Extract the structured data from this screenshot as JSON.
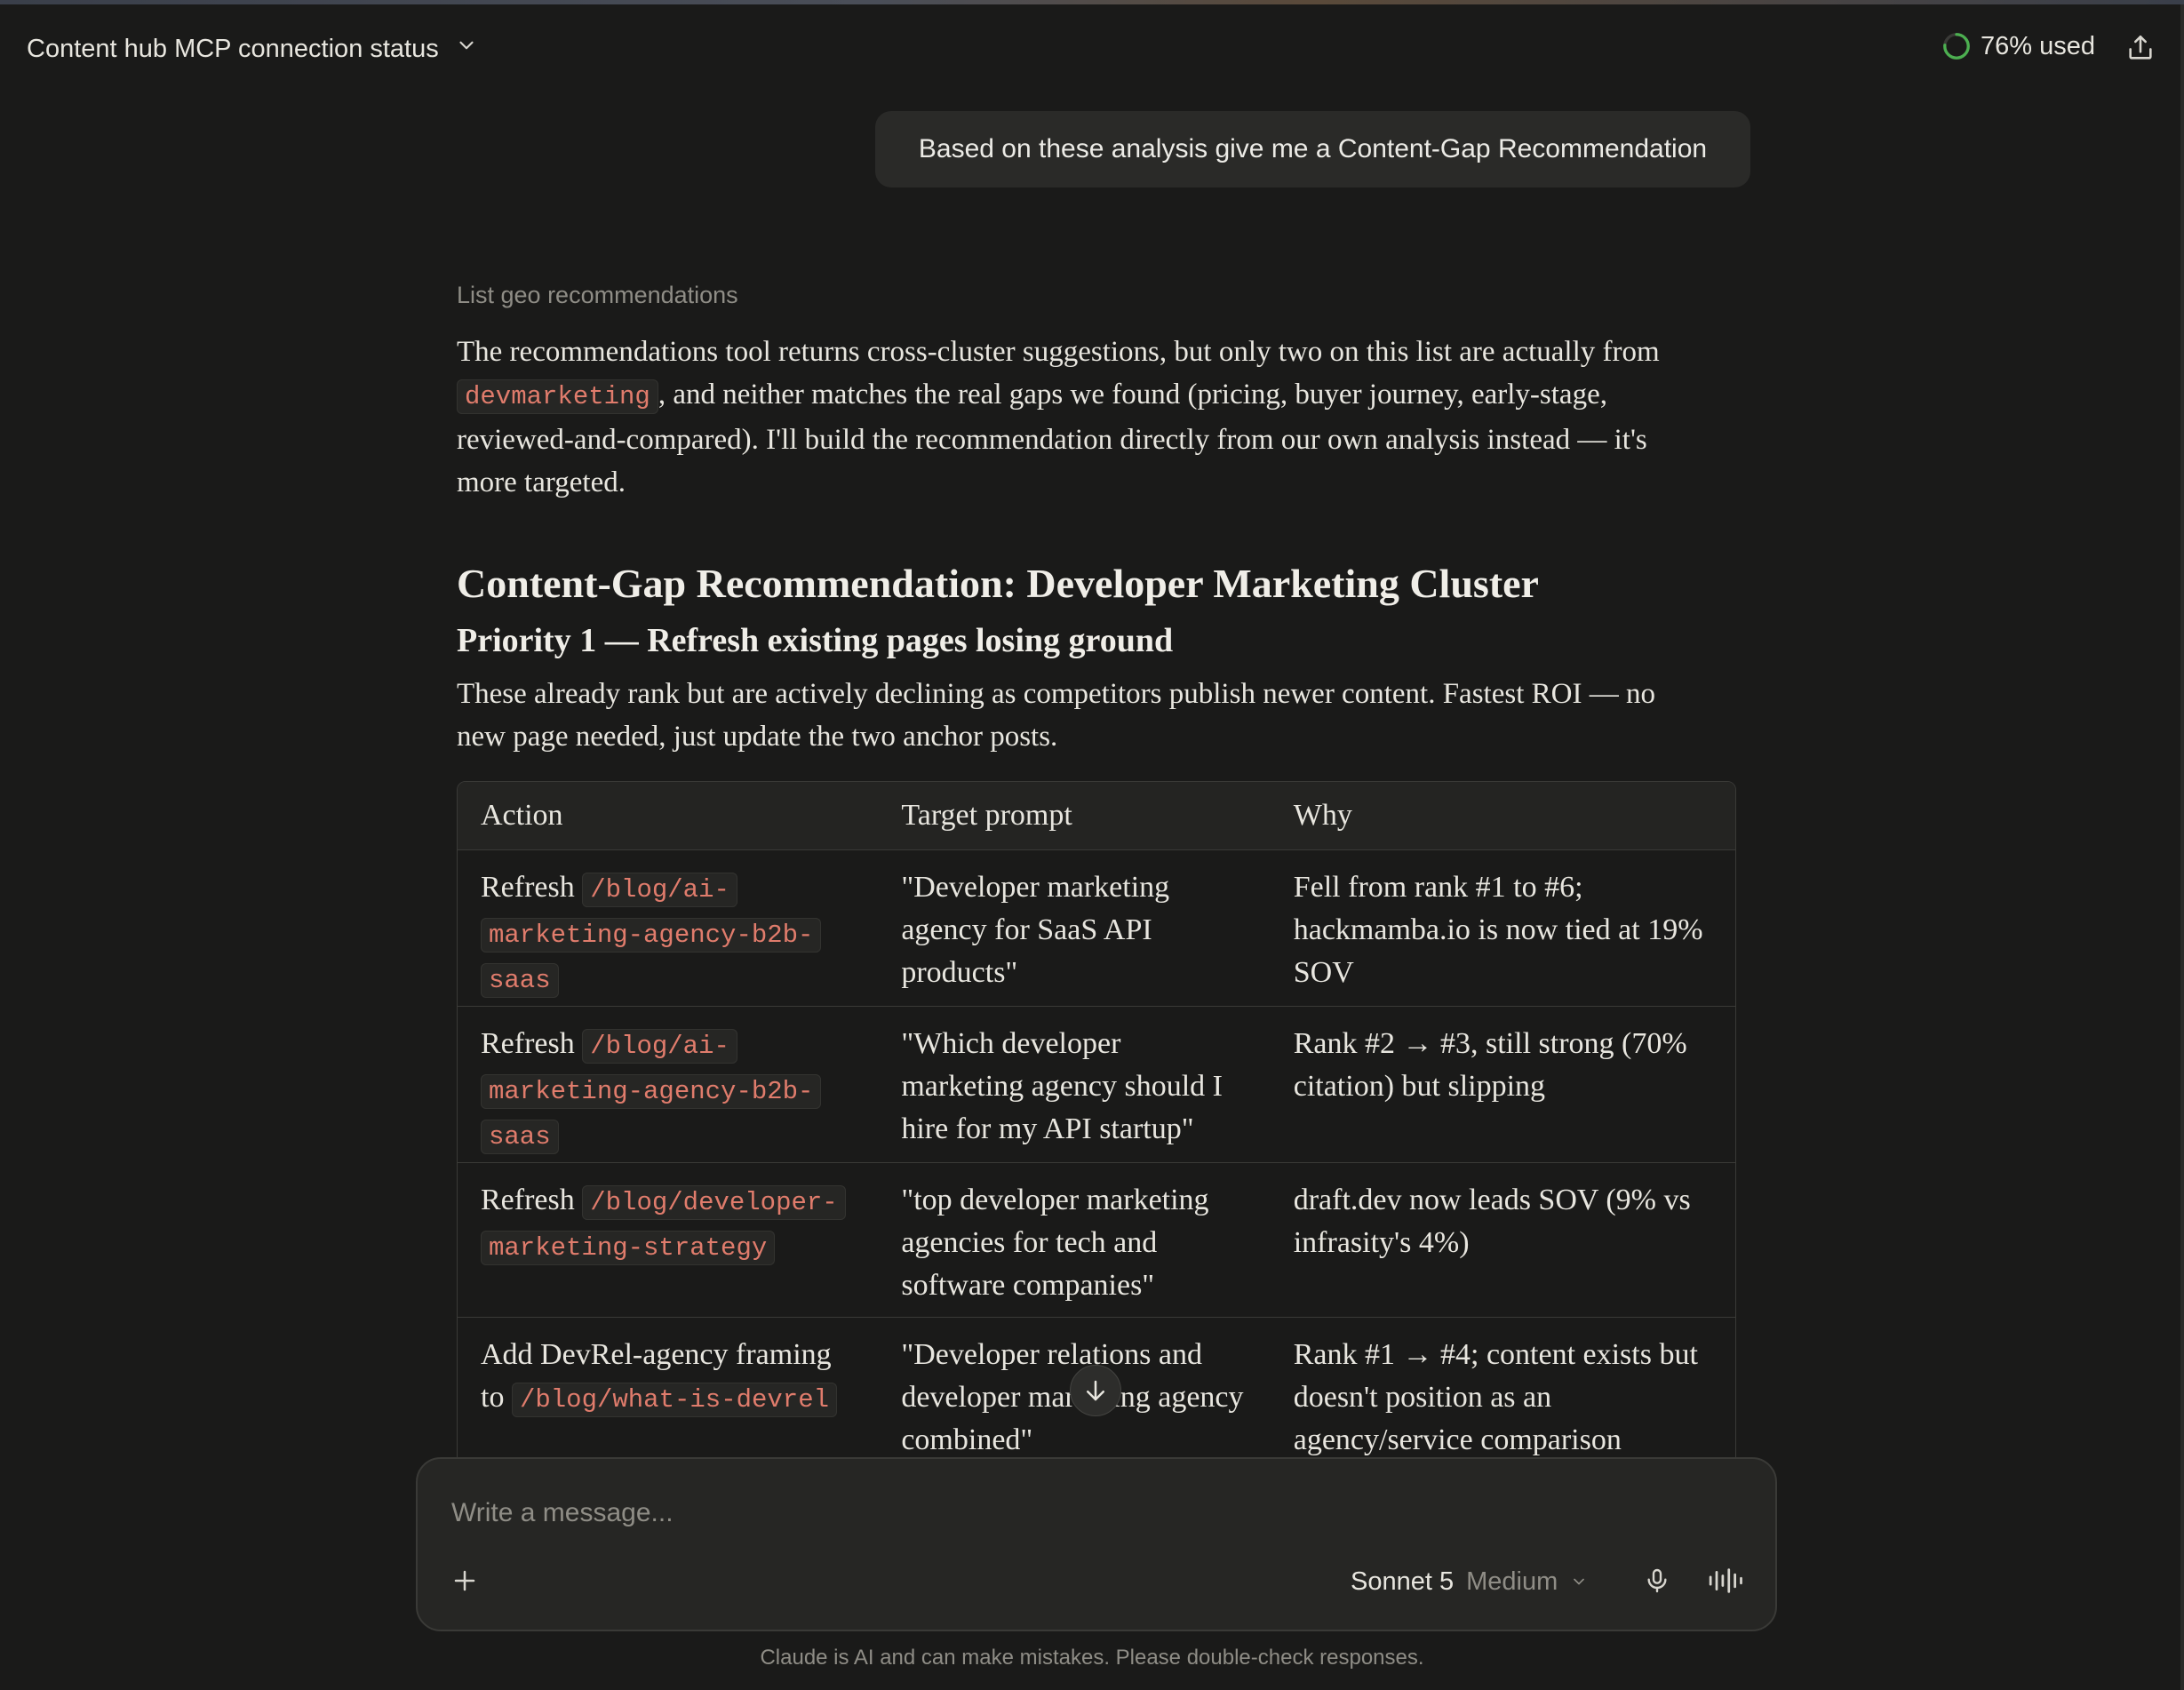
{
  "header": {
    "title": "Content hub MCP connection status",
    "usage_label": "76% used",
    "usage_fraction": 0.76,
    "usage_color": "#4caf50"
  },
  "user_message": "Based on these analysis give me a Content-Gap Recommendation",
  "assistant": {
    "tool_label": "List geo recommendations",
    "intro_part1": "The recommendations tool returns cross-cluster suggestions, but only two on this list are actually from ",
    "intro_code": "devmarketing",
    "intro_part2": ", and neither matches the real gaps we found (pricing, buyer journey, early-stage, reviewed-and-compared). I'll build the recommendation directly from our own analysis instead — it's more targeted.",
    "heading": "Content-Gap Recommendation: Developer Marketing Cluster",
    "subheading": "Priority 1 — Refresh existing pages losing ground",
    "subtext": "These already rank but are actively declining as competitors publish newer content. Fastest ROI — no new page needed, just update the two anchor posts.",
    "table": {
      "headers": [
        "Action",
        "Target prompt",
        "Why"
      ],
      "rows": [
        {
          "action_prefix": "Refresh ",
          "action_code": "/blog/ai-marketing-agency-b2b-saas",
          "action_code_lines": [
            "/blog/ai-",
            "marketing-agency-b2b-",
            "saas"
          ],
          "prompt": "\"Developer marketing agency for SaaS API products\"",
          "why": "Fell from rank #1 to #6; hackmamba.io is now tied at 19% SOV"
        },
        {
          "action_prefix": "Refresh ",
          "action_code": "/blog/ai-marketing-agency-b2b-saas",
          "action_code_lines": [
            "/blog/ai-",
            "marketing-agency-b2b-",
            "saas"
          ],
          "prompt": "\"Which developer marketing agency should I hire for my API startup\"",
          "why": "Rank #2 → #3, still strong (70% citation) but slipping"
        },
        {
          "action_prefix": "Refresh ",
          "action_code": "/blog/developer-marketing-strategy",
          "action_code_lines": [
            "/blog/developer-",
            "marketing-strategy"
          ],
          "prompt": "\"top developer marketing agencies for tech and software companies\"",
          "why": "draft.dev now leads SOV (9% vs infrasity's 4%)"
        },
        {
          "action_prefix": "Add DevRel-agency framing to ",
          "action_code": "/blog/what-is-devrel",
          "action_code_lines": [
            "/blog/what-is-devrel"
          ],
          "prompt": "\"Developer relations and developer marketing agency combined\"",
          "why": "Rank #1 → #4; content exists but doesn't position as an agency/service comparison"
        }
      ]
    }
  },
  "composer": {
    "placeholder": "Write a message...",
    "model_name": "Sonnet 5",
    "model_effort": "Medium"
  },
  "disclaimer": "Claude is AI and can make mistakes. Please double-check responses."
}
